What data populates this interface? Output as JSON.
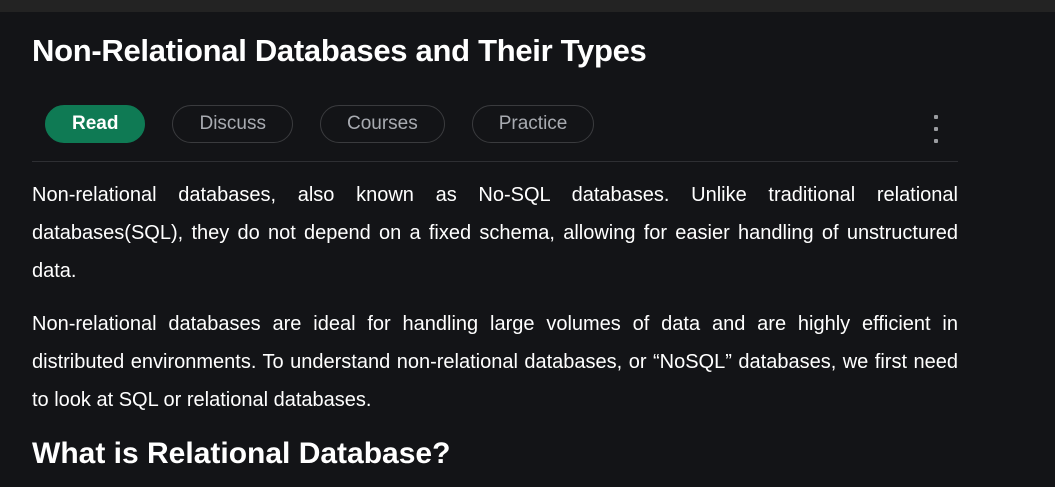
{
  "article": {
    "title": "Non-Relational Databases and Their Types",
    "tabs": [
      {
        "label": "Read",
        "active": true
      },
      {
        "label": "Discuss",
        "active": false
      },
      {
        "label": "Courses",
        "active": false
      },
      {
        "label": "Practice",
        "active": false
      }
    ],
    "more_icon": "vertical-ellipsis-icon",
    "paragraphs": [
      "Non-relational databases, also known as No-SQL databases. Unlike traditional relational databases(SQL), they do not depend on a fixed schema, allowing for easier handling of unstructured data.",
      "Non-relational databases are ideal for handling large volumes of data and are highly efficient in distributed environments. To understand non-relational databases, or “NoSQL” databases, we first need to look at SQL or relational databases."
    ],
    "heading": "What is Relational Database?"
  },
  "colors": {
    "accent": "#0f7a54",
    "background": "#131417"
  }
}
